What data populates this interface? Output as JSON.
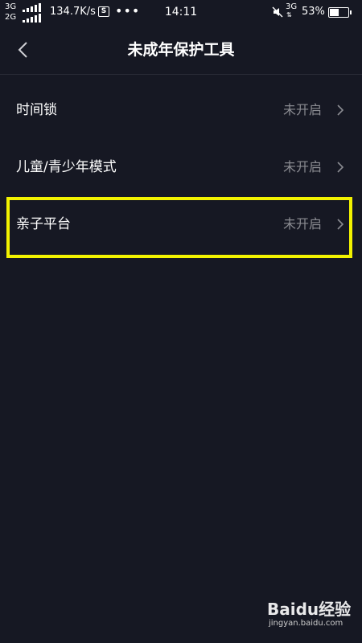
{
  "status_bar": {
    "sim1_label": "3G",
    "sim2_label": "2G",
    "net_speed": "134.7K/s",
    "app_badge": "S",
    "more_dots": "•••",
    "time": "14:11",
    "network_type": "3G",
    "battery_percent": "53%",
    "battery_level": 0.53
  },
  "nav": {
    "title": "未成年保护工具"
  },
  "items": [
    {
      "label": "时间锁",
      "status": "未开启"
    },
    {
      "label": "儿童/青少年模式",
      "status": "未开启"
    },
    {
      "label": "亲子平台",
      "status": "未开启"
    }
  ],
  "highlight_color": "#f2f200",
  "watermark": {
    "brand": "Baidu经验",
    "url": "jingyan.baidu.com"
  }
}
